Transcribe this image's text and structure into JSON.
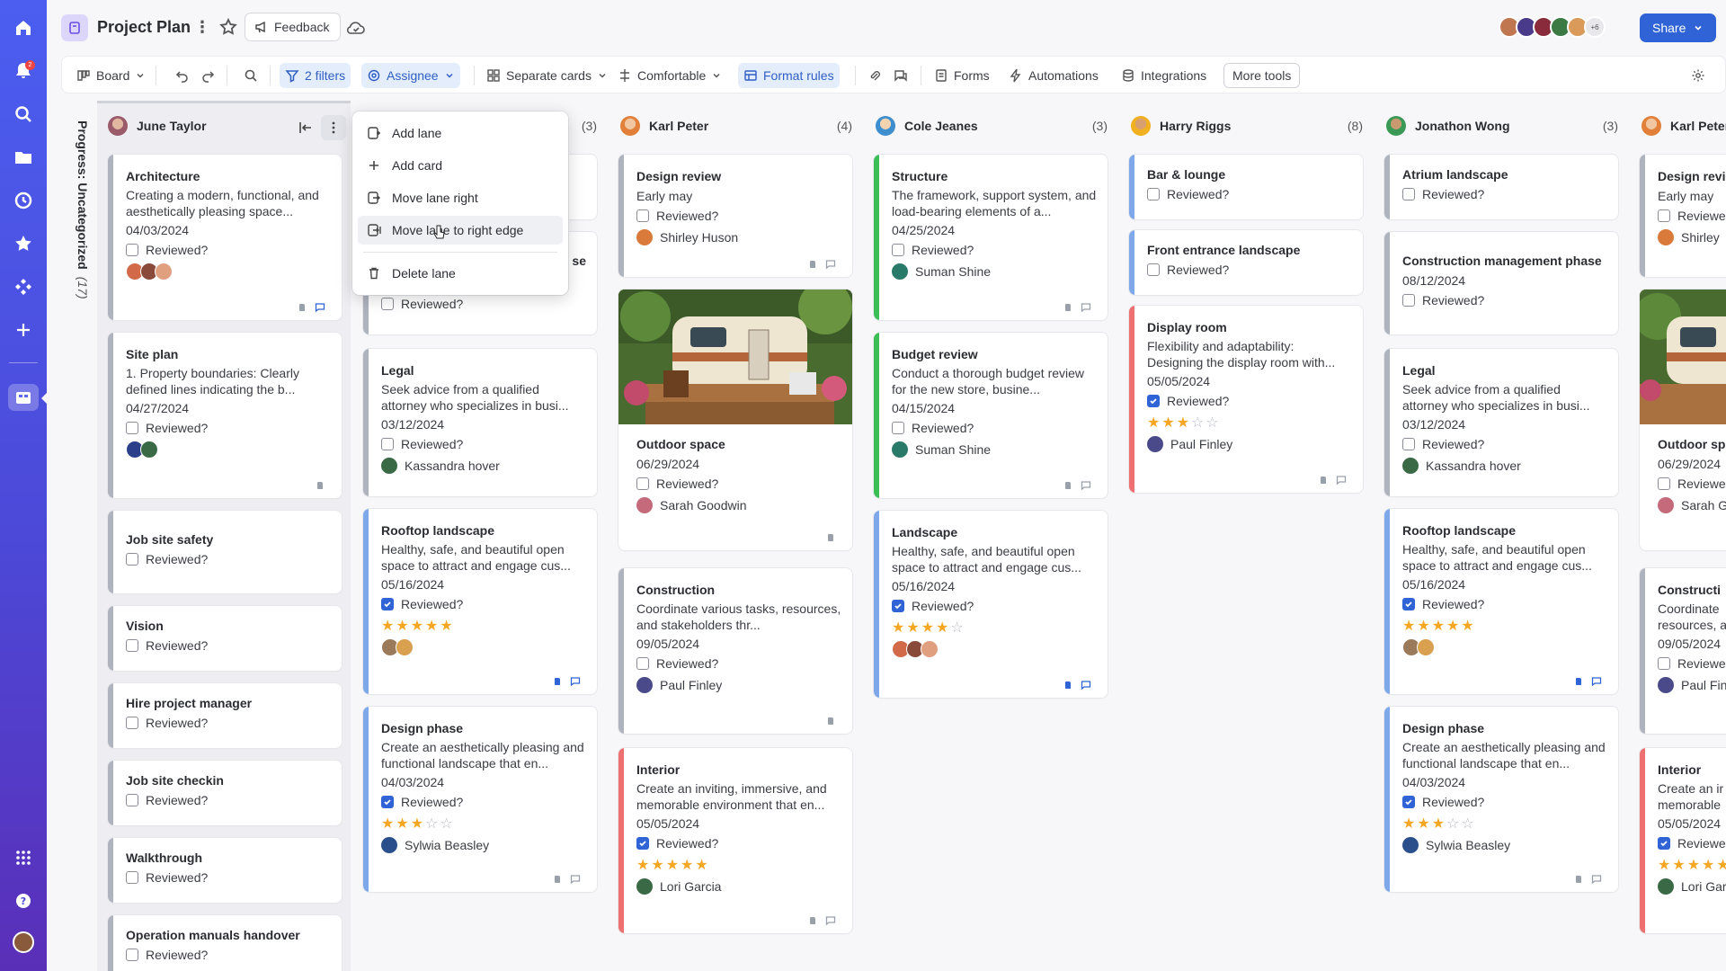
{
  "app": {
    "title": "Project Plan",
    "feedback_label": "Feedback",
    "share_label": "Share",
    "avatar_more": "+6",
    "notification_count": "2"
  },
  "toolbar": {
    "board": "Board",
    "filters": "2 filters",
    "assignee": "Assignee",
    "separate_cards": "Separate cards",
    "comfortable": "Comfortable",
    "format_rules": "Format rules",
    "forms": "Forms",
    "automations": "Automations",
    "integrations": "Integrations",
    "more_tools": "More tools"
  },
  "side": {
    "label": "Progress: Uncategorized",
    "count": "(17)"
  },
  "lanes": [
    {
      "name": "June Taylor",
      "count": ""
    },
    {
      "name": "",
      "count": "(3)"
    },
    {
      "name": "Karl Peter",
      "count": "(4)"
    },
    {
      "name": "Cole Jeanes",
      "count": "(3)"
    },
    {
      "name": "Harry Riggs",
      "count": "(8)"
    },
    {
      "name": "Jonathon Wong",
      "count": "(3)"
    },
    {
      "name": "Karl Peter",
      "count": ""
    }
  ],
  "menu": {
    "add_lane": "Add lane",
    "add_card": "Add card",
    "move_right": "Move lane right",
    "move_edge": "Move lane to right edge",
    "delete_lane": "Delete lane"
  },
  "reviewed": "Reviewed?",
  "cards": {
    "l0": [
      {
        "title": "Architecture",
        "desc": "Creating a modern, functional, and aesthetically pleasing space...",
        "date": "04/03/2024"
      },
      {
        "title": "Site plan",
        "desc": "1.  Property boundaries: Clearly defined lines indicating the b...",
        "date": "04/27/2024"
      },
      {
        "title": "Job site safety"
      },
      {
        "title": "Vision"
      },
      {
        "title": "Hire project manager"
      },
      {
        "title": "Job site checkin"
      },
      {
        "title": "Walkthrough"
      },
      {
        "title": "Operation manuals handover"
      }
    ],
    "l1": [
      {
        "title": "se"
      },
      {
        "title": "Legal",
        "desc": "Seek advice from a qualified attorney who specializes in busi...",
        "date": "03/12/2024",
        "person": "Kassandra hover"
      },
      {
        "title": "Rooftop landscape",
        "desc": "Healthy, safe, and beautiful open space to attract and engage cus...",
        "date": "05/16/2024"
      },
      {
        "title": "Design phase",
        "desc": "Create an aesthetically pleasing and functional landscape that en...",
        "date": "04/03/2024",
        "person": "Sylwia Beasley"
      }
    ],
    "l2": [
      {
        "title": "Design review",
        "desc": "Early may",
        "person": "Shirley Huson"
      },
      {
        "title": "Outdoor space",
        "date": "06/29/2024",
        "person": "Sarah Goodwin"
      },
      {
        "title": "Construction",
        "desc": "Coordinate various tasks, resources, and stakeholders thr...",
        "date": "09/05/2024",
        "person": "Paul Finley"
      },
      {
        "title": "Interior",
        "desc": "Create an inviting, immersive, and memorable environment that en...",
        "date": "05/05/2024",
        "person": "Lori Garcia"
      }
    ],
    "l3": [
      {
        "title": "Structure",
        "desc": "The framework, support system, and load-bearing elements of a...",
        "date": "04/25/2024",
        "person": "Suman Shine"
      },
      {
        "title": "Budget review",
        "desc": "Conduct a thorough budget review for the new store, busine...",
        "date": "04/15/2024",
        "person": "Suman Shine"
      },
      {
        "title": "Landscape",
        "desc": "Healthy, safe, and beautiful open space to attract and engage cus...",
        "date": "05/16/2024"
      }
    ],
    "l4": [
      {
        "title": "Bar & lounge"
      },
      {
        "title": "Front entrance landscape"
      },
      {
        "title": "Display room",
        "desc": "Flexibility and adaptability: Designing the display room with...",
        "date": "05/05/2024",
        "person": "Paul Finley"
      }
    ],
    "l5": [
      {
        "title": "Atrium landscape"
      },
      {
        "title": "Construction management phase",
        "date": "08/12/2024"
      },
      {
        "title": "Legal",
        "desc": "Seek advice from a qualified attorney who specializes in busi...",
        "date": "03/12/2024",
        "person": "Kassandra hover"
      },
      {
        "title": "Rooftop landscape",
        "desc": "Healthy, safe, and beautiful open space to attract and engage cus...",
        "date": "05/16/2024"
      },
      {
        "title": "Design phase",
        "desc": "Create an aesthetically pleasing and functional landscape that en...",
        "date": "04/03/2024",
        "person": "Sylwia Beasley"
      }
    ],
    "l6": [
      {
        "title": "Design revi",
        "desc": "Early may",
        "reviewed": "Reviewe",
        "person": "Shirley"
      },
      {
        "title": "Outdoor sp",
        "date": "06/29/2024",
        "reviewed": "Reviewe",
        "person": "Sarah G"
      },
      {
        "title": "Constructi",
        "desc": "Coordinate resources, a",
        "date": "09/05/2024",
        "reviewed": "Reviewe",
        "person": "Paul Fin"
      },
      {
        "title": "Interior",
        "desc": "Create an ir memorable",
        "date": "05/05/2024",
        "reviewed": "Reviewe",
        "person": "Lori Gar"
      }
    ]
  },
  "ratings": {
    "rooftop": 5,
    "design_phase": 3,
    "interior": 5,
    "landscape": 4,
    "display_room": 3
  },
  "colors": {
    "accent": "#2f63d6",
    "gray_bar": "#aeb3be",
    "blue_bar": "#7ea8ea",
    "green_bar": "#3bbf55",
    "red_bar": "#ef7070"
  }
}
